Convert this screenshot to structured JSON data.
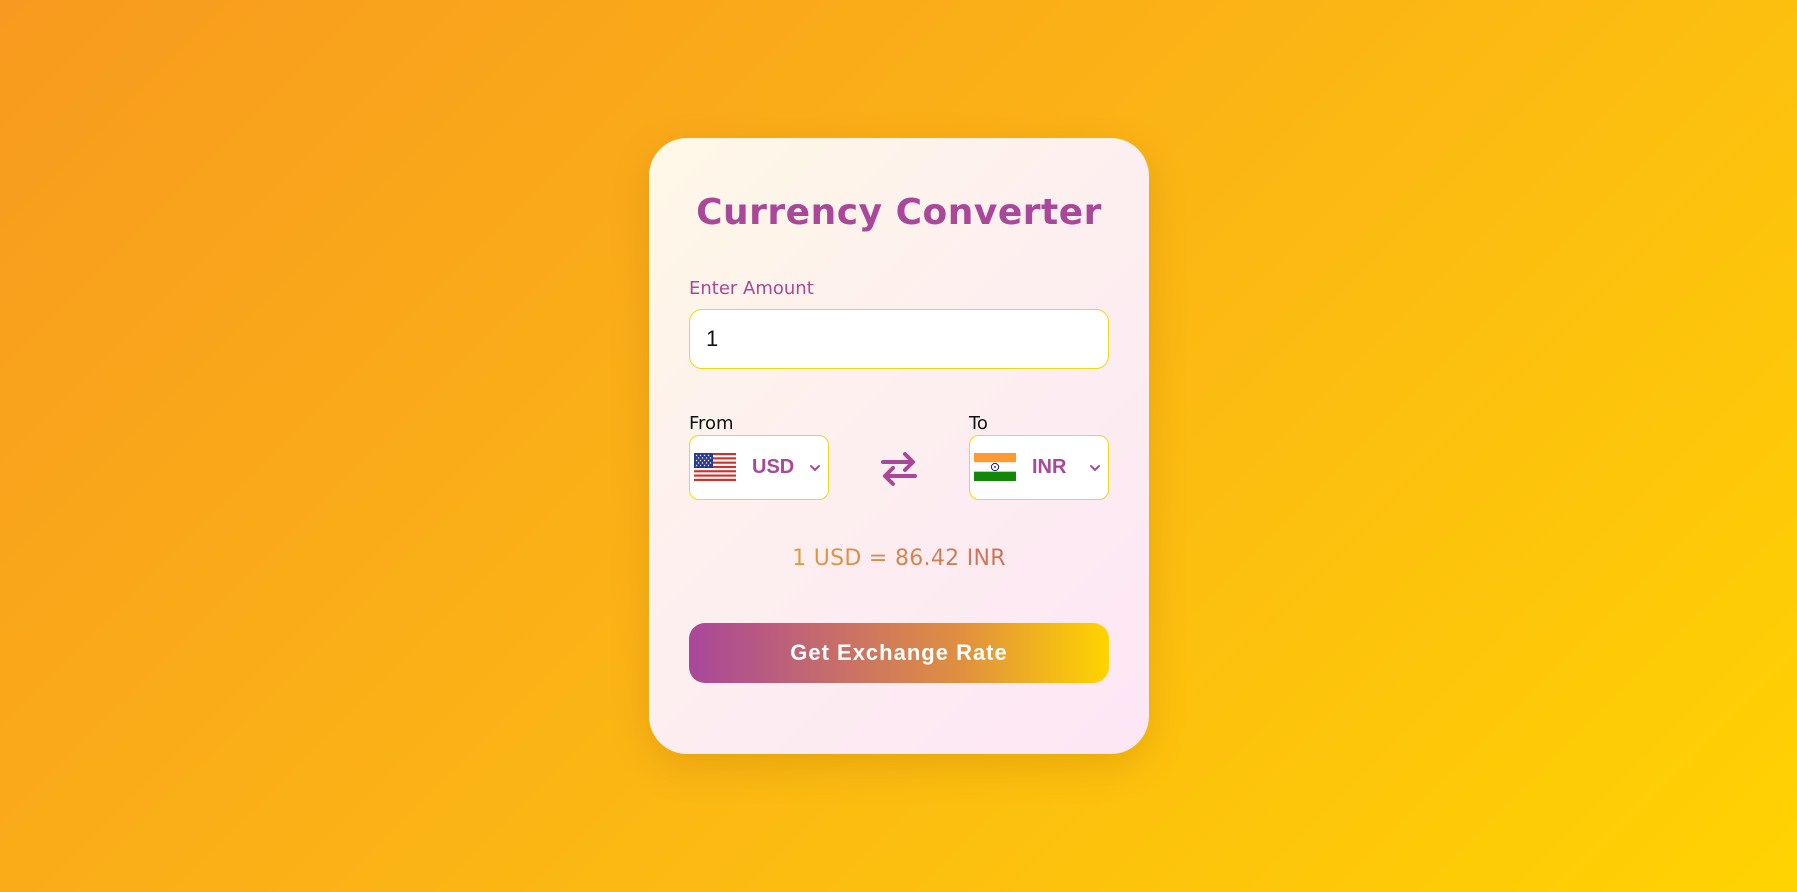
{
  "converter": {
    "title": "Currency Converter",
    "amount_label": "Enter Amount",
    "amount_value": "1",
    "from_label": "From",
    "to_label": "To",
    "from_currency": "USD",
    "to_currency": "INR",
    "rate_text": "1 USD = 86.42 INR",
    "button_label": "Get Exchange Rate",
    "icons": {
      "from_flag": "us-flag-icon",
      "to_flag": "india-flag-icon",
      "swap": "swap-arrows-icon",
      "dropdown": "chevron-down-icon"
    },
    "colors": {
      "accent": "#a9479a",
      "field_border": "#f2d519",
      "rate_start": "#e69a3b",
      "rate_end": "#c7735e",
      "button_start": "#a9479a",
      "button_end": "#ffd400"
    }
  }
}
